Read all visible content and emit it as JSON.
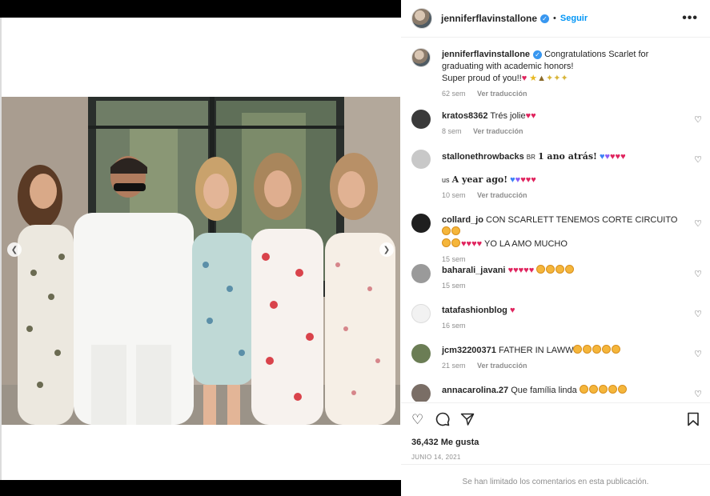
{
  "post": {
    "username": "jenniferflavinstallone",
    "follow_label": "Seguir",
    "separator": "•",
    "more_label": "•••",
    "caption_line1": "Congratulations Scarlet for graduating with academic honors!",
    "caption_line2": "Super proud of you!!",
    "caption_time": "62 sem",
    "translate_label": "Ver traducción"
  },
  "comments": [
    {
      "user": "kratos8362",
      "text": "Trés jolie",
      "time": "8 sem",
      "translate": "Ver traducción"
    },
    {
      "user": "stallonethrowbacks",
      "prefix": "BR",
      "text": "1 ano atrás!",
      "text2_prefix": "us",
      "text2": "A year ago!",
      "time": "10 sem",
      "translate": "Ver traducción"
    },
    {
      "user": "collard_jo",
      "text": "CON SCARLETT TENEMOS CORTE CIRCUITO",
      "text2": "YO LA AMO MUCHO",
      "time": "15 sem"
    },
    {
      "user": "baharali_javani",
      "text": "",
      "time": "15 sem"
    },
    {
      "user": "tatafashionblog",
      "text": "",
      "time": "16 sem"
    },
    {
      "user": "jcm32200371",
      "text": "FATHER IN LAWW",
      "time": "21 sem",
      "translate": "Ver traducción"
    },
    {
      "user": "annacarolina.27",
      "text": "Que família linda",
      "time": ""
    }
  ],
  "stats": {
    "likes": "36,432 Me gusta",
    "date": "JUNIO 14, 2021"
  },
  "footer": {
    "limited": "Se han limitado los comentarios en esta publicación."
  },
  "icons": {
    "like": "heart-icon",
    "comment": "comment-icon",
    "share": "share-icon",
    "save": "bookmark-icon"
  },
  "colors": {
    "link": "#0095f6",
    "muted": "#8e8e8e",
    "verified": "#3897f0",
    "heart_red": "#e0245e"
  }
}
